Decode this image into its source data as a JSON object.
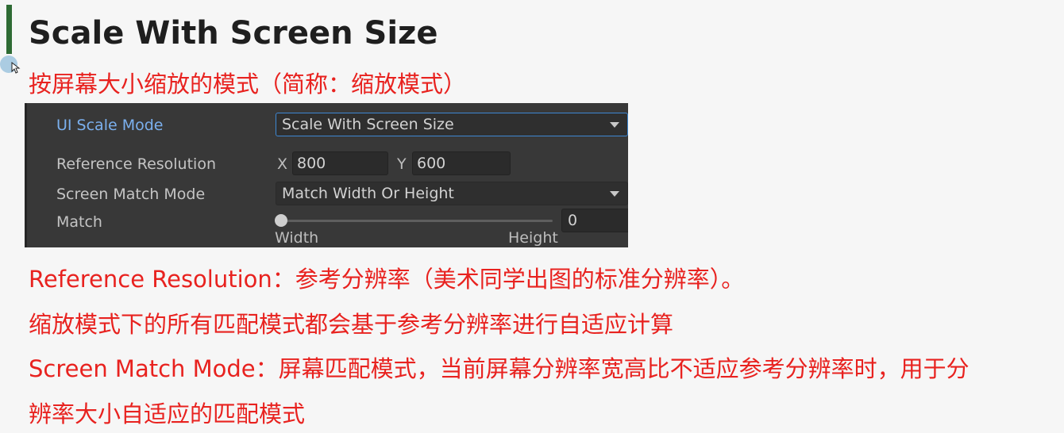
{
  "slide": {
    "title": "Scale With Screen Size",
    "subtitle": "按屏幕大小缩放的模式（简称：缩放模式）",
    "descriptions": [
      "Reference Resolution：参考分辨率（美术同学出图的标准分辨率）。",
      "缩放模式下的所有匹配模式都会基于参考分辨率进行自适应计算",
      "Screen Match Mode：屏幕匹配模式，当前屏幕分辨率宽高比不适应参考分辨率时，用于分",
      "辨率大小自适应的匹配模式"
    ]
  },
  "inspector": {
    "ui_scale_mode": {
      "label": "UI Scale Mode",
      "value": "Scale With Screen Size"
    },
    "reference_resolution": {
      "label": "Reference Resolution",
      "x_label": "X",
      "x_value": "800",
      "y_label": "Y",
      "y_value": "600"
    },
    "screen_match_mode": {
      "label": "Screen Match Mode",
      "value": "Match Width Or Height"
    },
    "match": {
      "label": "Match",
      "value": "0",
      "slider_fraction": 0,
      "left_label": "Width",
      "right_label": "Height"
    }
  },
  "icons": {
    "cursor": "move-cursor-icon",
    "dropdown_arrow": "triangle-down-icon"
  },
  "colors": {
    "accent_bar": "#2e6b34",
    "annotation_text": "#e8221f",
    "inspector_bg": "#383838",
    "active_label": "#7bb0ee",
    "focus_border": "#3d87d3"
  }
}
